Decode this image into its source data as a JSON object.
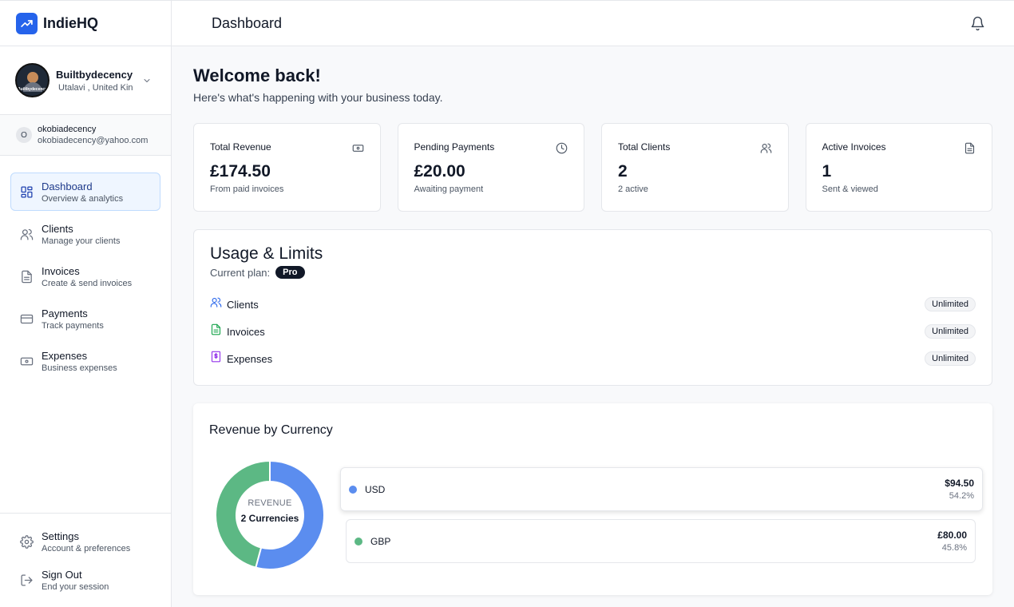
{
  "brand": {
    "name": "IndieHQ"
  },
  "profile": {
    "name": "Builtbydecency",
    "location": "Utalavi , United Kin",
    "avatar_text": "Builtbydecency"
  },
  "account": {
    "initial": "O",
    "name": "okobiadecency",
    "email": "okobiadecency@yahoo.com"
  },
  "nav": [
    {
      "label": "Dashboard",
      "sub": "Overview & analytics",
      "icon": "dashboard-icon",
      "active": true
    },
    {
      "label": "Clients",
      "sub": "Manage your clients",
      "icon": "users-icon"
    },
    {
      "label": "Invoices",
      "sub": "Create & send invoices",
      "icon": "document-icon"
    },
    {
      "label": "Payments",
      "sub": "Track payments",
      "icon": "credit-card-icon"
    },
    {
      "label": "Expenses",
      "sub": "Business expenses",
      "icon": "banknote-icon"
    }
  ],
  "bottom_nav": [
    {
      "label": "Settings",
      "sub": "Account & preferences",
      "icon": "gear-icon"
    },
    {
      "label": "Sign Out",
      "sub": "End your session",
      "icon": "logout-icon"
    }
  ],
  "header": {
    "title": "Dashboard"
  },
  "welcome": {
    "title": "Welcome back!",
    "subtitle": "Here's what's happening with your business today."
  },
  "stats": [
    {
      "title": "Total Revenue",
      "value": "£174.50",
      "sub": "From paid invoices",
      "icon": "banknote-icon"
    },
    {
      "title": "Pending Payments",
      "value": "£20.00",
      "sub": "Awaiting payment",
      "icon": "clock-icon"
    },
    {
      "title": "Total Clients",
      "value": "2",
      "sub": "2 active",
      "icon": "users-icon"
    },
    {
      "title": "Active Invoices",
      "value": "1",
      "sub": "Sent & viewed",
      "icon": "document-icon"
    }
  ],
  "usage": {
    "title": "Usage & Limits",
    "plan_label": "Current plan:",
    "plan": "Pro",
    "items": [
      {
        "label": "Clients",
        "limit": "Unlimited",
        "icon": "users-icon",
        "color": "#2563eb"
      },
      {
        "label": "Invoices",
        "limit": "Unlimited",
        "icon": "document-icon",
        "color": "#16a34a"
      },
      {
        "label": "Expenses",
        "limit": "Unlimited",
        "icon": "receipt-icon",
        "color": "#9333ea"
      }
    ]
  },
  "revenue": {
    "title": "Revenue by Currency",
    "center_caption": "REVENUE",
    "center_count": "2 Currencies",
    "currencies": [
      {
        "code": "USD",
        "amount": "$94.50",
        "percent": "54.2%",
        "share": 54.2,
        "color": "#5b8def"
      },
      {
        "code": "GBP",
        "amount": "£80.00",
        "percent": "45.8%",
        "share": 45.8,
        "color": "#5cb884"
      }
    ]
  },
  "colors": {
    "accent": "#2563eb",
    "active_bg": "#eff6ff",
    "dark_badge": "#111827"
  }
}
